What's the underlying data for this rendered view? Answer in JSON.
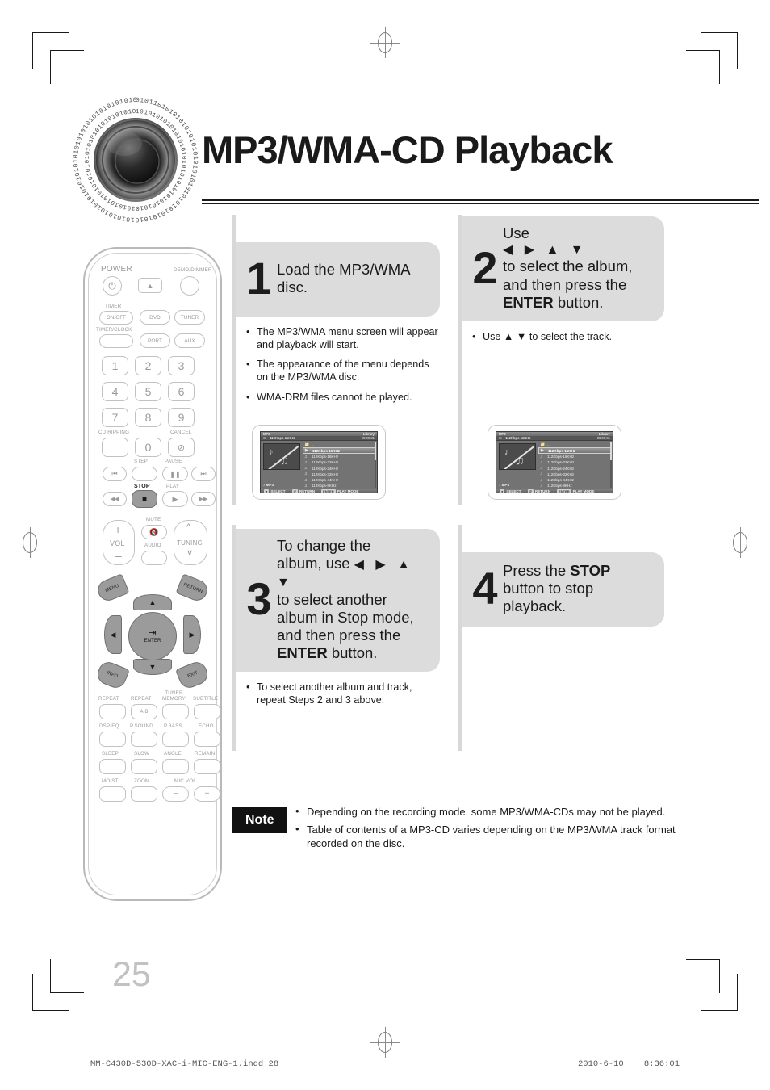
{
  "page": {
    "title": "MP3/WMA-CD Playback",
    "number": "25",
    "note_badge": "Note"
  },
  "footer": {
    "file": "MM-C430D-530D-XAC-i-MIC-ENG-1.indd    28",
    "timestamp": "2010-6-10    8:36:01"
  },
  "steps": [
    {
      "number": "1",
      "line1": "Load the MP3/WMA",
      "line2": "disc.",
      "bullets": [
        "The MP3/WMA menu screen will appear and playback will start.",
        "The appearance of the menu depends on the MP3/WMA disc.",
        "WMA-DRM files cannot be played."
      ]
    },
    {
      "number": "2",
      "line1": "Use",
      "arrows": "◀ ▶ ▲ ▼",
      "line2": "to select the album,",
      "line3": "and then press the",
      "bold": "ENTER",
      "line4": " button.",
      "bullets": [
        "Use ▲ ▼ to select the track."
      ]
    },
    {
      "number": "3",
      "line1": "To change the",
      "line2": "album, use",
      "arrows": "◀ ▶ ▲ ▼",
      "line3": "to select another",
      "line4": "album in Stop mode,",
      "line5": "and then press the",
      "bold": "ENTER",
      "line6": " button.",
      "bullets": [
        "To select another album and track, repeat Steps 2 and 3 above."
      ]
    },
    {
      "number": "4",
      "line1": "Press the ",
      "bold": "STOP",
      "line2": "button to stop",
      "line3": "playback.",
      "bullets": []
    }
  ],
  "tv_screen": {
    "header_left": "MP3",
    "header_right": "Library",
    "drive": "C:",
    "bitrate": "112Kbps-11KHz",
    "time": "00:00:31",
    "art_label": "MP3",
    "folder_row": "..",
    "rows": [
      "112Kbps-11KHz",
      "112Kbps-16KHz",
      "112Kbps-22KHz",
      "112Kbps-24KHz",
      "112Kbps-32KHz",
      "112Kbps-44KHz",
      "112Kbps-8KHz"
    ],
    "selected_index": 0,
    "bottom_bar": [
      {
        "key": "●",
        "label": "SELECT"
      },
      {
        "key": "↺",
        "label": "RETURN"
      },
      {
        "key": "ENTER",
        "label": "PLAY MODE"
      }
    ]
  },
  "notes": [
    "Depending on the recording mode, some MP3/WMA-CDs may not be played.",
    "Table of contents of a MP3-CD varies depending on the MP3/WMA track format recorded on the disc."
  ],
  "remote": {
    "power_label": "POWER",
    "demo_label": "DEMO/DIMMER",
    "timer_label": "TIMER",
    "onoff_label": "ON/OFF",
    "timerclock_label": "TIMER/CLOCK",
    "source_buttons": [
      "DVD",
      "TUNER",
      "PORT",
      "AUX"
    ],
    "numbers": [
      "1",
      "2",
      "3",
      "4",
      "5",
      "6",
      "7",
      "8",
      "9",
      "0"
    ],
    "cd_ripping_label": "CD RIPPING",
    "cancel_label": "CANCEL",
    "transport": {
      "step": "STEP",
      "pause": "PAUSE",
      "stop": "STOP",
      "play": "PLAY",
      "prev": "⏮",
      "next": "⏭",
      "rew": "◀◀",
      "ff": "▶▶",
      "pause_icon": "⏸",
      "stop_icon": "■",
      "play_icon": "▶"
    },
    "vol_label": "VOL",
    "mute_label": "MUTE",
    "audio_label": "AUDIO",
    "tuning_label": "TUNING",
    "menu_label": "MENU",
    "return_label": "RETURN",
    "enter_label": "ENTER",
    "info_label": "INFO",
    "exit_label": "EXIT",
    "function_rows": [
      [
        "REPEAT",
        "REPEAT\nA-B",
        "TUNER\nMEMORY",
        "SUBTITLE"
      ],
      [
        "DSP/EQ",
        "P.SOUND",
        "P.BASS",
        "ECHO"
      ],
      [
        "SLEEP",
        "SLOW",
        "ANGLE",
        "REMAIN"
      ],
      [
        "MO/ST",
        "ZOOM",
        "MIC VOL",
        ""
      ]
    ],
    "ab_label": "A-B",
    "mic_vol_label": "MIC VOL",
    "mic_minus": "−",
    "mic_plus": "+"
  },
  "colors": {
    "step_box_bg": "#dcdcdc",
    "rule": "#d8d8d8",
    "page_number": "#c2c2c2",
    "ink": "#1a1a1a"
  }
}
